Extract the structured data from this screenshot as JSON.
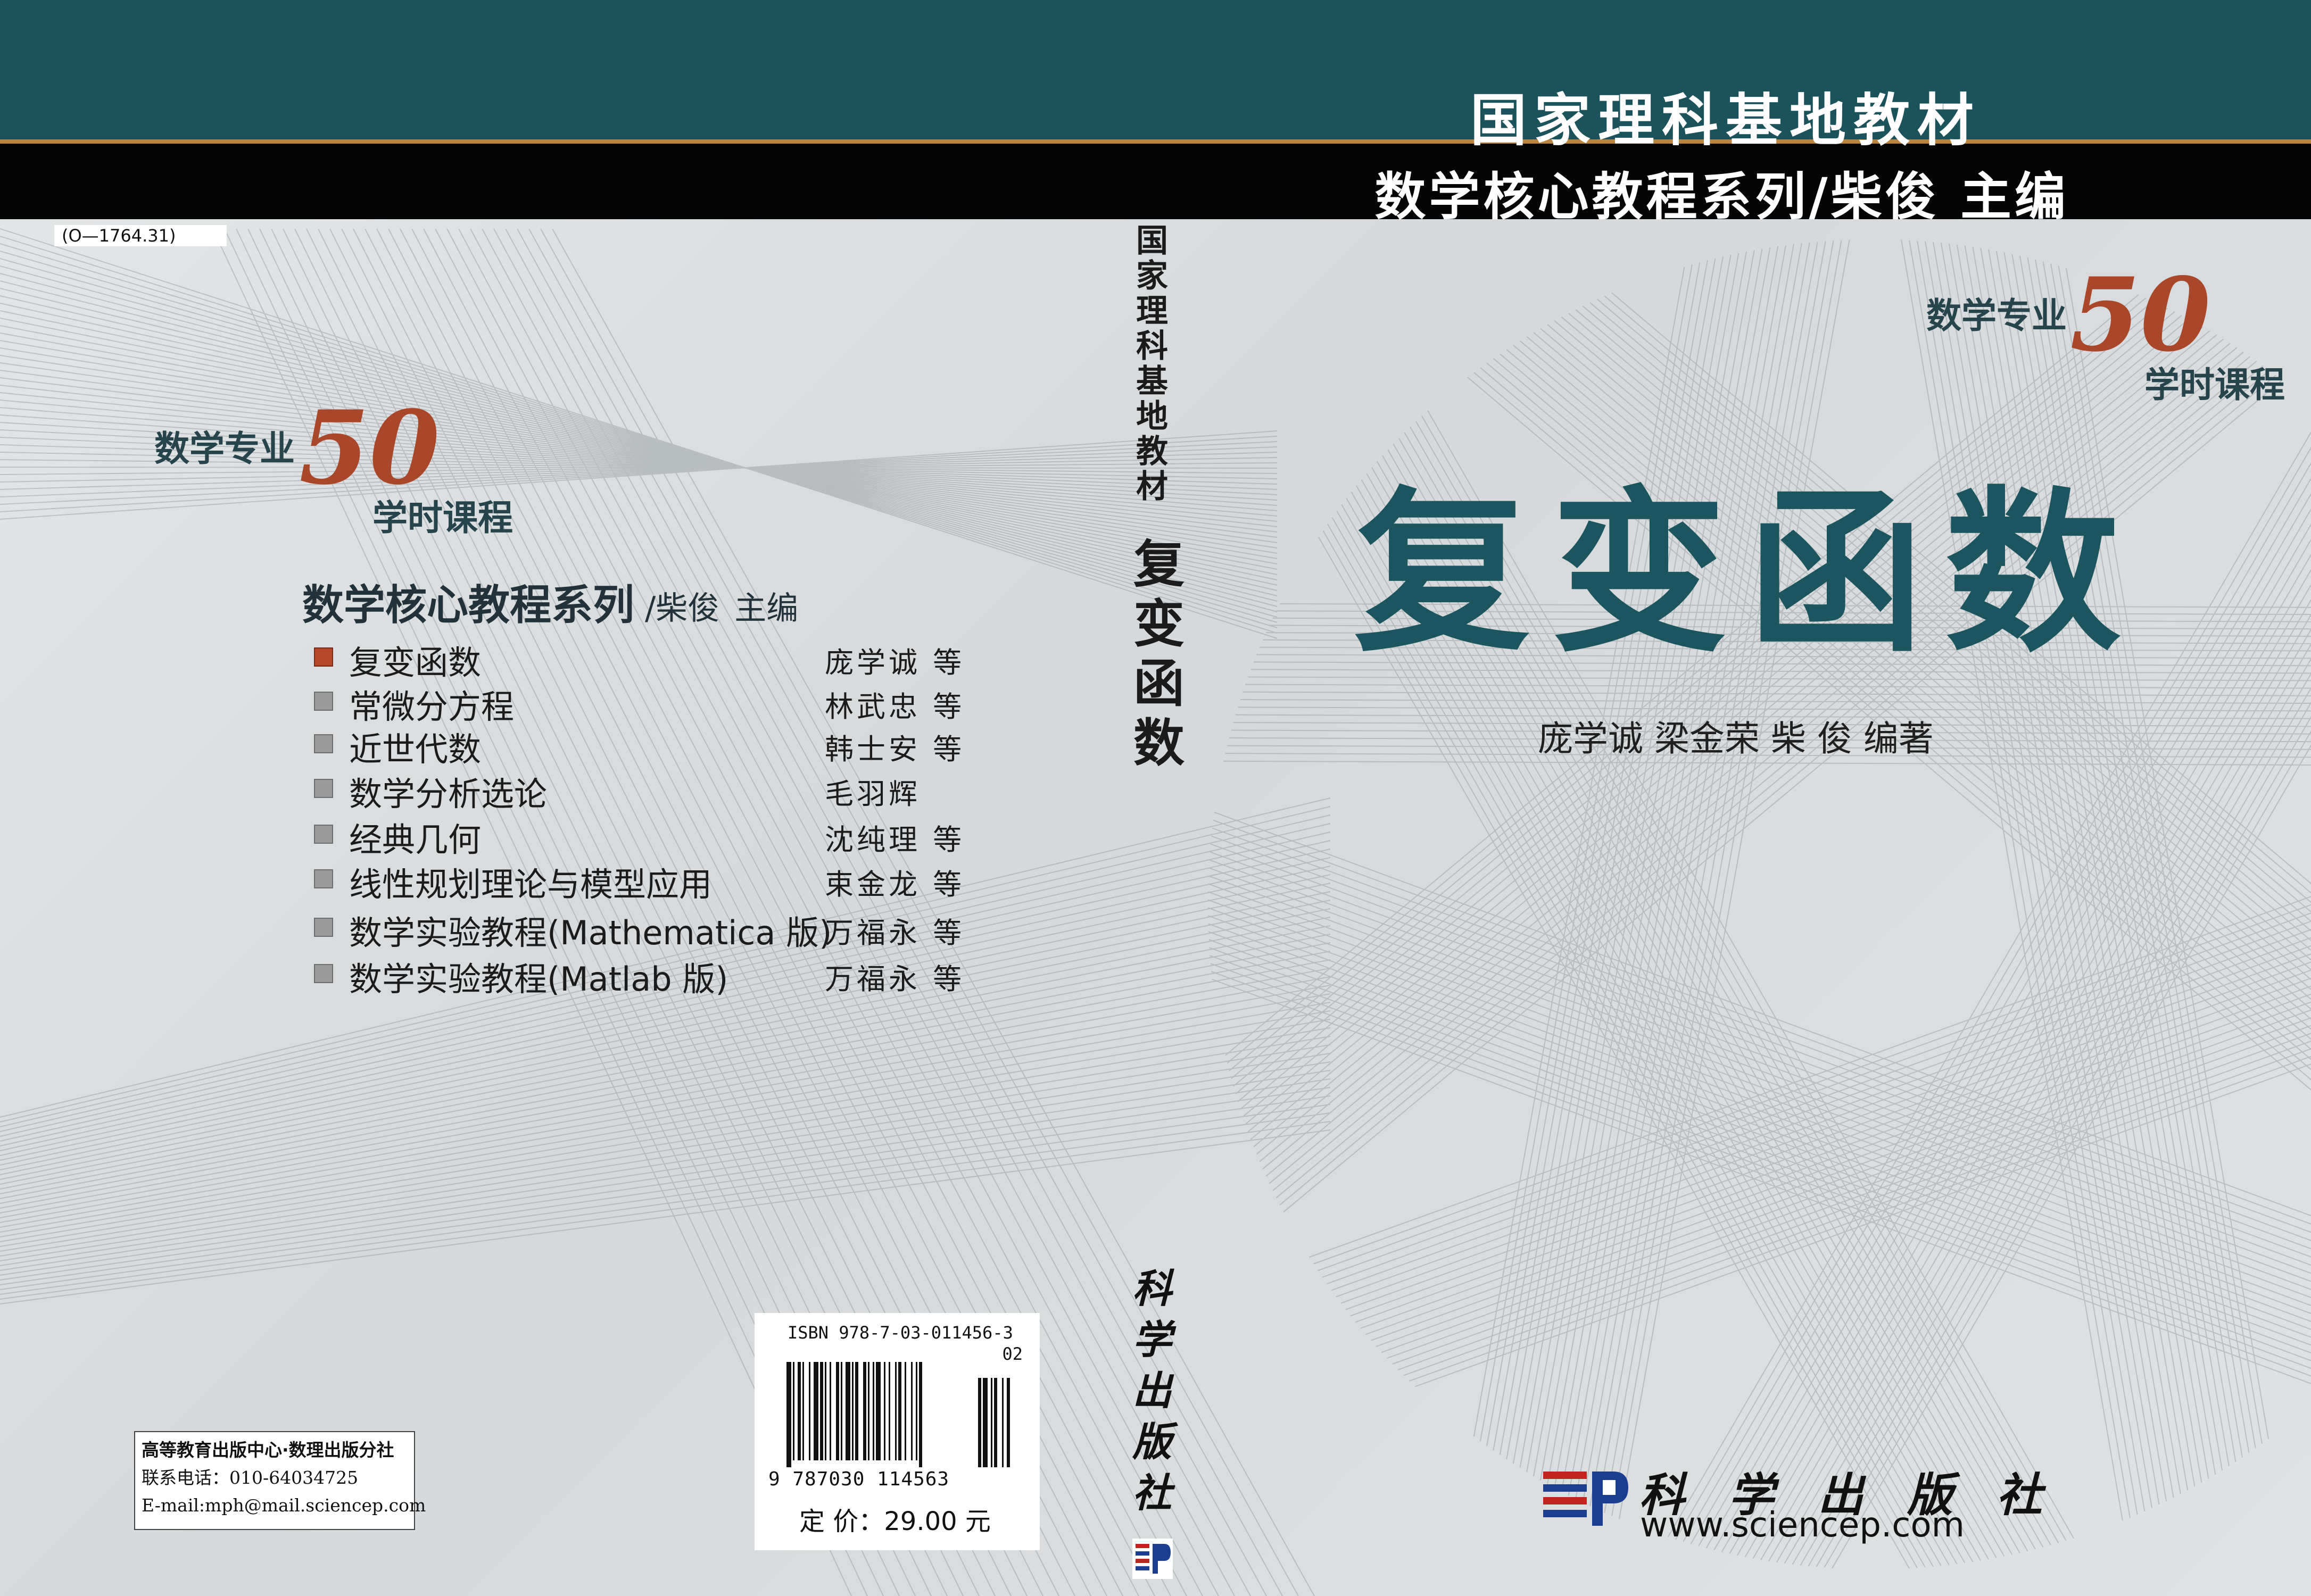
{
  "header": {
    "title": "国家理科基地教材",
    "series_line": "数学核心教程系列/柴俊 主编"
  },
  "catalog_code": "(O—1764.31)",
  "badge": {
    "top": "数学专业",
    "number": "50",
    "bottom": "学时课程"
  },
  "back": {
    "series_title": "数学核心教程系列",
    "series_editor": "/柴俊",
    "series_role": "主编",
    "books": [
      {
        "title": "复变函数",
        "author": "庞学诚  等",
        "active": true
      },
      {
        "title": "常微分方程",
        "author": "林武忠  等",
        "active": false
      },
      {
        "title": "近世代数",
        "author": "韩士安  等",
        "active": false
      },
      {
        "title": "数学分析选论",
        "author": "毛羽辉",
        "active": false
      },
      {
        "title": "经典几何",
        "author": "沈纯理  等",
        "active": false
      },
      {
        "title": "线性规划理论与模型应用",
        "author": "束金龙  等",
        "active": false
      },
      {
        "title": "数学实验教程(Mathematica 版)",
        "author": "万福永  等",
        "active": false
      },
      {
        "title": "数学实验教程(Matlab 版)",
        "author": "万福永  等",
        "active": false
      }
    ],
    "contact": {
      "dept": "高等教育出版中心·数理出版分社",
      "phone": "联系电话：010-64034725",
      "email": "E-mail:mph@mail.sciencep.com"
    },
    "isbn": {
      "text": "ISBN 978-7-03-011456-3",
      "supplement": "02",
      "digits": "9 787030 114563",
      "price": "定  价：29.00 元"
    }
  },
  "spine": {
    "series": "国家理科基地教材",
    "title": "复变函数",
    "publisher": "科学出版社"
  },
  "front": {
    "title": "复变函数",
    "authors": "庞学诚   梁金荣   柴 俊 编著",
    "publisher": "科 学 出 版 社",
    "url": "www.sciencep.com"
  },
  "colors": {
    "teal": "#1c525b",
    "title_teal": "#1c5560",
    "badge_red": "#a9472b",
    "gold_line": "#b9853f",
    "background": "#dcdfe0"
  }
}
